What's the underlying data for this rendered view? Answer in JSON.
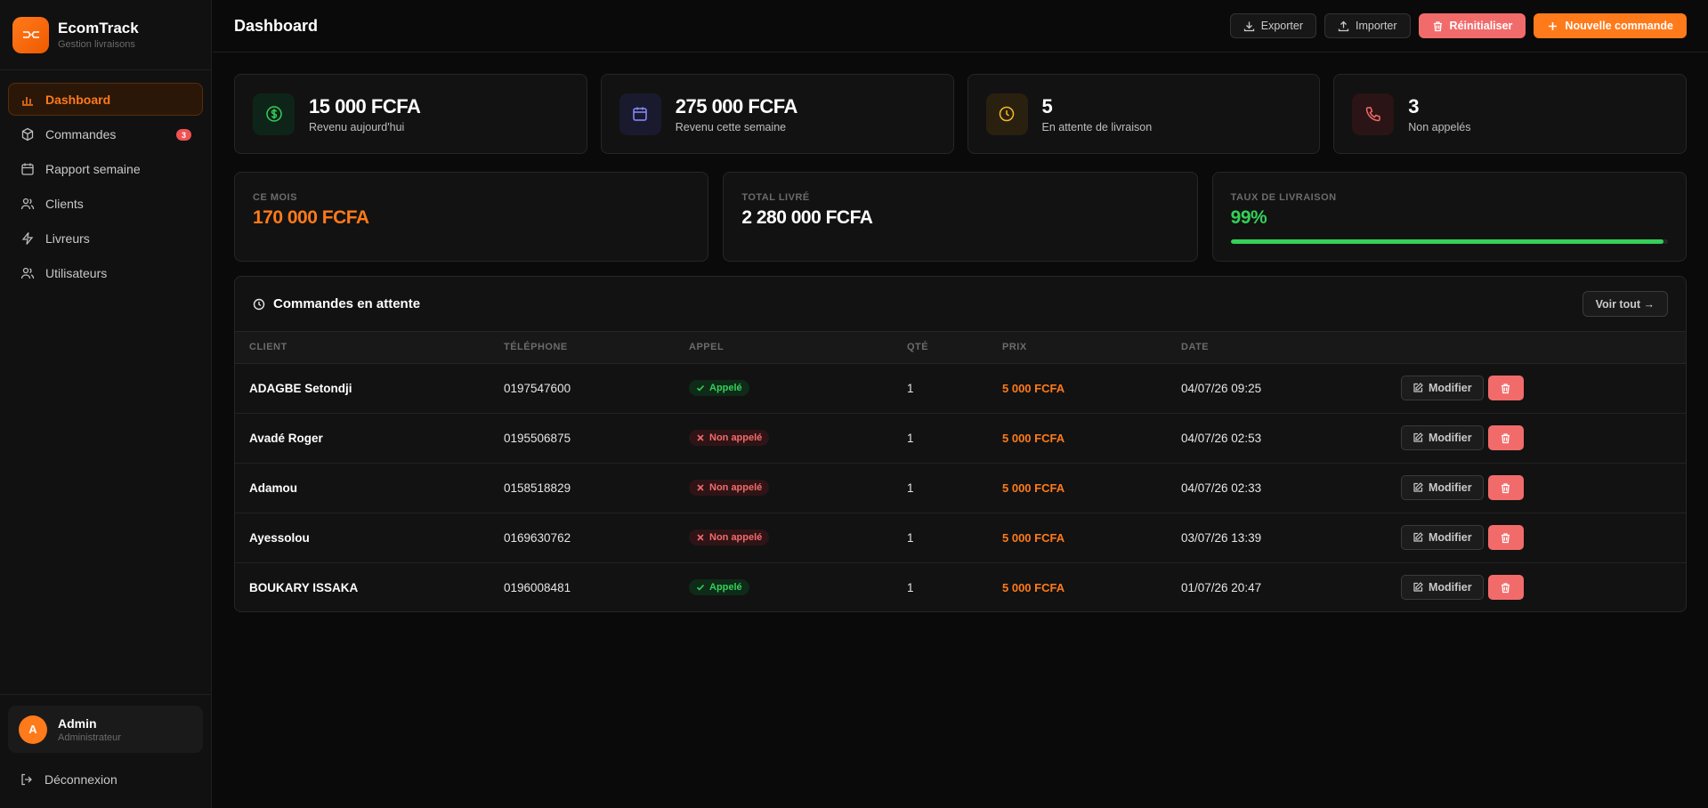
{
  "brand": {
    "title": "EcomTrack",
    "subtitle": "Gestion livraisons"
  },
  "sidebar": {
    "items": [
      {
        "label": "Dashboard",
        "icon": "bar-chart-icon",
        "active": true
      },
      {
        "label": "Commandes",
        "icon": "package-icon",
        "badge": "3"
      },
      {
        "label": "Rapport semaine",
        "icon": "calendar-icon"
      },
      {
        "label": "Clients",
        "icon": "users-icon"
      },
      {
        "label": "Livreurs",
        "icon": "lightning-icon"
      },
      {
        "label": "Utilisateurs",
        "icon": "users-icon"
      }
    ]
  },
  "user": {
    "initial": "A",
    "name": "Admin",
    "role": "Administrateur"
  },
  "logout_label": "Déconnexion",
  "header": {
    "title": "Dashboard",
    "export_label": "Exporter",
    "import_label": "Importer",
    "reset_label": "Réinitialiser",
    "new_order_label": "Nouvelle commande"
  },
  "stats": [
    {
      "value": "15 000 FCFA",
      "label": "Revenu aujourd'hui",
      "icon": "dollar-icon",
      "color": "#34d058"
    },
    {
      "value": "275 000 FCFA",
      "label": "Revenu cette semaine",
      "icon": "calendar-icon",
      "color": "#8b8bff"
    },
    {
      "value": "5",
      "label": "En attente de livraison",
      "icon": "clock-icon",
      "color": "#f5b921"
    },
    {
      "value": "3",
      "label": "Non appelés",
      "icon": "phone-icon",
      "color": "#f26b6b"
    }
  ],
  "summary": {
    "month_label": "CE MOIS",
    "month_value": "170 000 FCFA",
    "delivered_label": "TOTAL LIVRÉ",
    "delivered_value": "2 280 000 FCFA",
    "rate_label": "TAUX DE LIVRAISON",
    "rate_value": "99%",
    "rate_fraction": 0.99
  },
  "orders": {
    "title": "Commandes en attente",
    "see_all_label": "Voir tout →",
    "columns": [
      "CLIENT",
      "TÉLÉPHONE",
      "APPEL",
      "QTÉ",
      "PRIX",
      "DATE"
    ],
    "edit_label": "Modifier",
    "rows": [
      {
        "client": "ADAGBE Setondji",
        "phone": "0197547600",
        "call": "Appelé",
        "called": true,
        "qty": "1",
        "price": "5 000 FCFA",
        "date": "04/07/26 09:25"
      },
      {
        "client": "Avadé Roger",
        "phone": "0195506875",
        "call": "Non appelé",
        "called": false,
        "qty": "1",
        "price": "5 000 FCFA",
        "date": "04/07/26 02:53"
      },
      {
        "client": "Adamou",
        "phone": "0158518829",
        "call": "Non appelé",
        "called": false,
        "qty": "1",
        "price": "5 000 FCFA",
        "date": "04/07/26 02:33"
      },
      {
        "client": "Ayessolou",
        "phone": "0169630762",
        "call": "Non appelé",
        "called": false,
        "qty": "1",
        "price": "5 000 FCFA",
        "date": "03/07/26 13:39"
      },
      {
        "client": "BOUKARY ISSAKA",
        "phone": "0196008481",
        "call": "Appelé",
        "called": true,
        "qty": "1",
        "price": "5 000 FCFA",
        "date": "01/07/26 20:47"
      }
    ]
  },
  "colors": {
    "accent": "#ff7a1a",
    "danger": "#f26b6b",
    "success": "#34d058"
  }
}
